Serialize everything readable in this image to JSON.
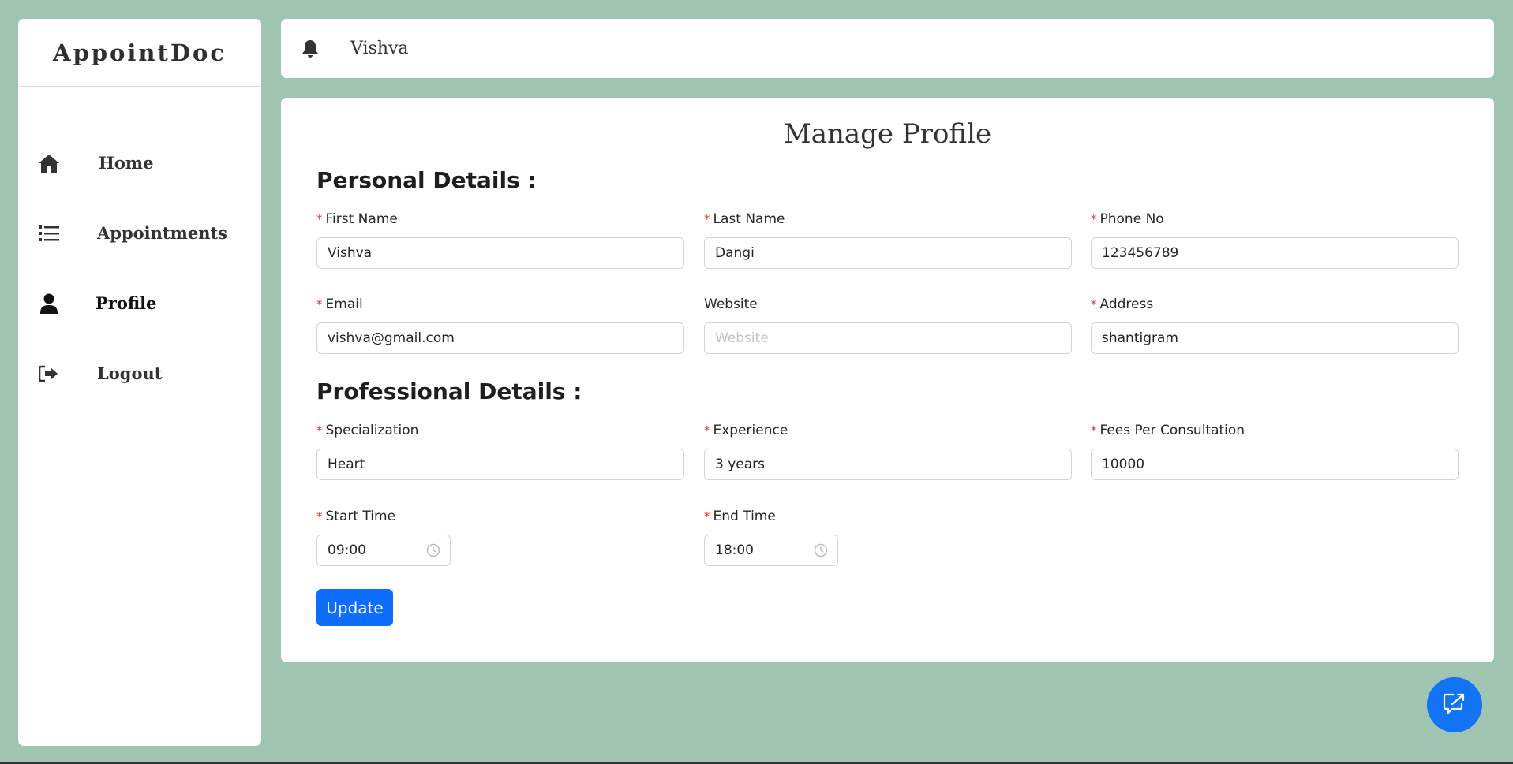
{
  "app": {
    "logo": "AppointDoc"
  },
  "sidebar": {
    "items": [
      {
        "label": "Home",
        "icon": "home-icon"
      },
      {
        "label": "Appointments",
        "icon": "list-icon"
      },
      {
        "label": "Profile",
        "icon": "user-icon"
      },
      {
        "label": "Logout",
        "icon": "logout-icon"
      }
    ]
  },
  "header": {
    "username": "Vishva",
    "icon": "bell-icon"
  },
  "page": {
    "title": "Manage Profile",
    "personal_title": "Personal Details :",
    "professional_title": "Professional Details :",
    "required_mark": "*"
  },
  "form": {
    "first_name": {
      "label": "First Name",
      "value": "Vishva",
      "required": true
    },
    "last_name": {
      "label": "Last Name",
      "value": "Dangi",
      "required": true
    },
    "phone": {
      "label": "Phone No",
      "value": "123456789",
      "required": true
    },
    "email": {
      "label": "Email",
      "value": "vishva@gmail.com",
      "required": true
    },
    "website": {
      "label": "Website",
      "value": "",
      "placeholder": "Website",
      "required": false
    },
    "address": {
      "label": "Address",
      "value": "shantigram",
      "required": true
    },
    "specialization": {
      "label": "Specialization",
      "value": "Heart",
      "required": true
    },
    "experience": {
      "label": "Experience",
      "value": "3 years",
      "required": true
    },
    "fees": {
      "label": "Fees Per Consultation",
      "value": "10000",
      "required": true
    },
    "start_time": {
      "label": "Start Time",
      "value": "09:00",
      "required": true
    },
    "end_time": {
      "label": "End Time",
      "value": "18:00",
      "required": true
    }
  },
  "actions": {
    "update_label": "Update"
  },
  "colors": {
    "background": "#a0c4b2",
    "primary": "#0d6efd",
    "required": "#e03131"
  }
}
